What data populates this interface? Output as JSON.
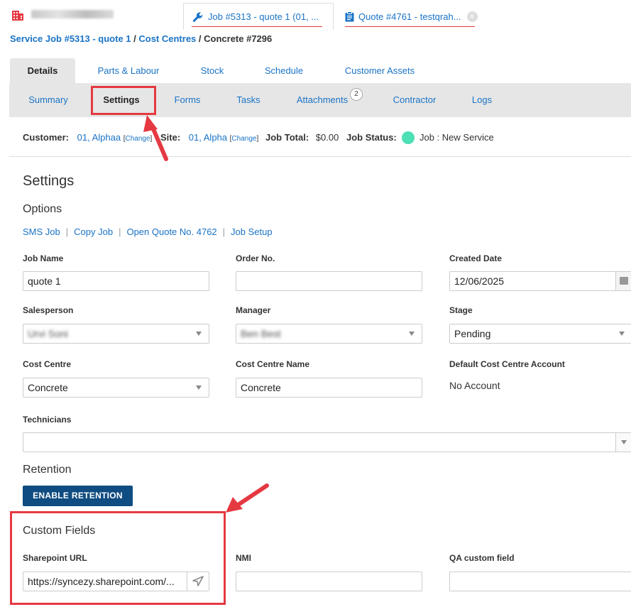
{
  "window_tabs": [
    {
      "label": "Job #5313 - quote 1 (01, ...",
      "icon": "wrench-icon",
      "active": true
    },
    {
      "label": "Quote #4761 - testqrah...",
      "icon": "clipboard-icon",
      "active": false
    }
  ],
  "breadcrumb": {
    "job": "Service Job #5313 - quote 1",
    "sep1": " / ",
    "cost_centres": "Cost Centres",
    "sep2": " / ",
    "current": "Concrete #7296"
  },
  "primary_tabs": [
    "Details",
    "Parts & Labour",
    "Stock",
    "Schedule",
    "Customer Assets"
  ],
  "sub_tabs": [
    "Summary",
    "Settings",
    "Forms",
    "Tasks",
    "Attachments",
    "Contractor",
    "Logs"
  ],
  "attachments_count": "2",
  "info_bar": {
    "customer_label": "Customer:",
    "customer_value": "01, Alphaa",
    "change_label": "Change",
    "site_label": "Site:",
    "site_value": "01, Alpha",
    "job_total_label": "Job Total:",
    "job_total_value": "$0.00",
    "job_status_label": "Job Status:",
    "job_status_value": "Job : New Service",
    "status_color": "#4de0b4"
  },
  "page_title": "Settings",
  "options_title": "Options",
  "options_links": [
    "SMS Job",
    "Copy Job",
    "Open Quote No. 4762",
    "Job Setup"
  ],
  "fields": {
    "job_name": {
      "label": "Job Name",
      "value": "quote 1"
    },
    "order_no": {
      "label": "Order No.",
      "value": ""
    },
    "created_date": {
      "label": "Created Date",
      "value": "12/06/2025"
    },
    "salesperson": {
      "label": "Salesperson",
      "value": "Urvi Soni"
    },
    "manager": {
      "label": "Manager",
      "value": "Ben Best"
    },
    "stage": {
      "label": "Stage",
      "value": "Pending"
    },
    "cost_centre": {
      "label": "Cost Centre",
      "value": "Concrete"
    },
    "cost_centre_name": {
      "label": "Cost Centre Name",
      "value": "Concrete"
    },
    "default_account": {
      "label": "Default Cost Centre Account",
      "value": "No Account"
    },
    "technicians": {
      "label": "Technicians",
      "value": ""
    }
  },
  "retention_title": "Retention",
  "enable_retention_label": "ENABLE RETENTION",
  "custom_fields_title": "Custom Fields",
  "custom_fields": {
    "sharepoint": {
      "label": "Sharepoint URL",
      "value": "https://syncezy.sharepoint.com/..."
    },
    "nmi": {
      "label": "NMI",
      "value": ""
    },
    "qa": {
      "label": "QA custom field",
      "value": ""
    }
  },
  "colors": {
    "accent": "#1a73c6",
    "highlight": "#e53942",
    "button": "#0f4c81"
  }
}
